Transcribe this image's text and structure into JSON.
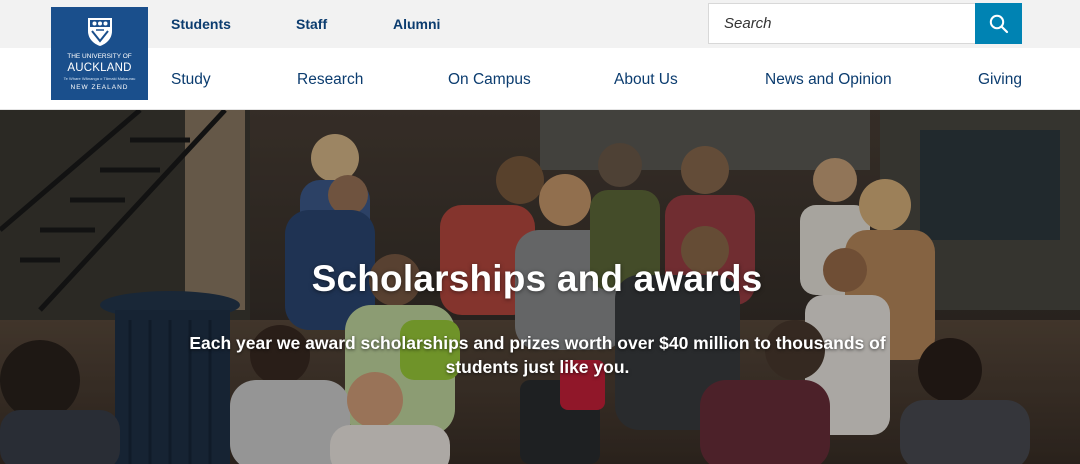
{
  "utility_nav": [
    {
      "label": "Students"
    },
    {
      "label": "Staff"
    },
    {
      "label": "Alumni"
    }
  ],
  "search": {
    "placeholder": "Search"
  },
  "logo": {
    "line1": "THE UNIVERSITY OF",
    "line2": "AUCKLAND",
    "line3": "Te Whare Wānanga o Tāmaki Makaurau",
    "line4": "NEW ZEALAND"
  },
  "main_nav": [
    {
      "label": "Study"
    },
    {
      "label": "Research"
    },
    {
      "label": "On Campus"
    },
    {
      "label": "About Us"
    },
    {
      "label": "News and Opinion"
    },
    {
      "label": "Giving"
    }
  ],
  "hero": {
    "title": "Scholarships and awards",
    "subtitle": "Each year we award scholarships and prizes worth over $40 million to thousands of students just like you."
  },
  "colors": {
    "brand_navy": "#0b3c6f",
    "logo_blue": "#1a4f8c",
    "search_button": "#0083b3"
  },
  "icons": {
    "search": "search-icon",
    "crest": "university-crest-icon"
  }
}
